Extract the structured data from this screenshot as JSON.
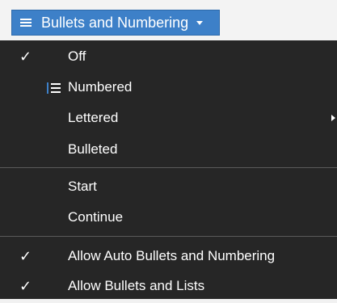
{
  "toolbar": {
    "dropdown_label": "Bullets and Numbering",
    "dropdown_icon": "list-icon",
    "accent_color": "#3d80c8"
  },
  "menu": {
    "background": "#262626",
    "check_glyph": "✓",
    "items": [
      {
        "label": "Off",
        "checked": true
      },
      {
        "label": "Numbered",
        "checked": false,
        "icon": "numbered-list-icon"
      },
      {
        "label": "Lettered",
        "checked": false,
        "has_submenu": true
      },
      {
        "label": "Bulleted",
        "checked": false
      },
      {
        "label": "Start",
        "checked": false
      },
      {
        "label": "Continue",
        "checked": false
      },
      {
        "label": "Allow Auto Bullets and Numbering",
        "checked": true
      },
      {
        "label": "Allow Bullets and Lists",
        "checked": true
      }
    ]
  }
}
